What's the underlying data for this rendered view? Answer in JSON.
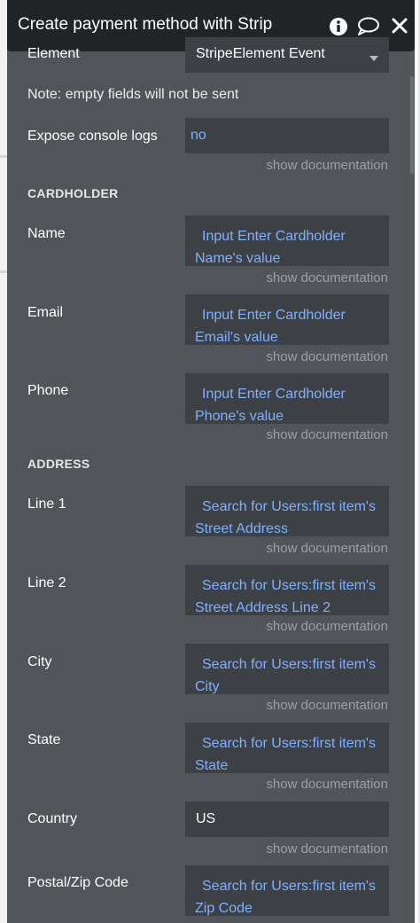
{
  "header": {
    "title": "Create payment method with Strip",
    "icons": [
      "info-icon",
      "comment-icon",
      "close-icon"
    ]
  },
  "element": {
    "label": "Element",
    "value": "StripeElement Event"
  },
  "note": "Note: empty fields will not be sent",
  "console": {
    "label": "Expose console logs",
    "value": "no"
  },
  "doc_link": "show documentation",
  "cardholder": {
    "section": "CARDHOLDER",
    "name": {
      "label": "Name",
      "value": "Input Enter Cardholder Name's value"
    },
    "email": {
      "label": "Email",
      "value": "Input Enter Cardholder Email's value"
    },
    "phone": {
      "label": "Phone",
      "value": "Input Enter Cardholder Phone's value"
    }
  },
  "address": {
    "section": "ADDRESS",
    "line1": {
      "label": "Line 1",
      "value": "Search for Users:first item's Street Address"
    },
    "line2": {
      "label": "Line 2",
      "value": "Search for Users:first item's Street Address Line 2"
    },
    "city": {
      "label": "City",
      "value": "Search for Users:first item's City"
    },
    "state": {
      "label": "State",
      "value": "Search for Users:first item's State"
    },
    "country": {
      "label": "Country",
      "value": "US"
    },
    "postal": {
      "label": "Postal/Zip Code",
      "value": "Search for Users:first item's Zip Code"
    }
  },
  "colors": {
    "panel_bg": "#515559",
    "field_bg": "#3d4145",
    "titlebar_bg": "#202427",
    "dynamic_text": "#7eb1ff",
    "doc_link": "#9ba0a5"
  }
}
